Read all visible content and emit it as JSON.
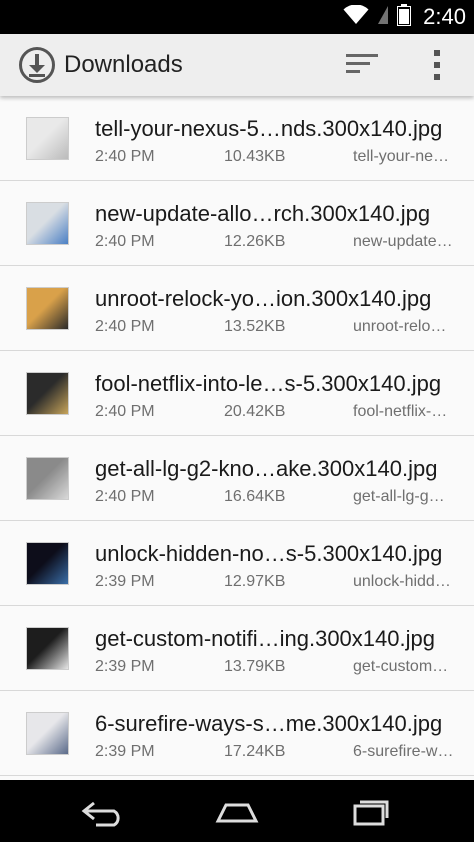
{
  "status_bar": {
    "time": "2:40"
  },
  "app_bar": {
    "title": "Downloads"
  },
  "downloads": [
    {
      "name": "tell-your-nexus-5…nds.300x140.jpg",
      "time": "2:40 PM",
      "size": "10.43KB",
      "source": "tell-your-ne…",
      "thumb_colors": [
        "#e9e9e9",
        "#bbbbbb"
      ]
    },
    {
      "name": "new-update-allo…rch.300x140.jpg",
      "time": "2:40 PM",
      "size": "12.26KB",
      "source": "new-update…",
      "thumb_colors": [
        "#d9dee3",
        "#4a7fc4"
      ]
    },
    {
      "name": "unroot-relock-yo…ion.300x140.jpg",
      "time": "2:40 PM",
      "size": "13.52KB",
      "source": "unroot-relo…",
      "thumb_colors": [
        "#d9a14a",
        "#2a2a2a"
      ]
    },
    {
      "name": "fool-netflix-into-le…s-5.300x140.jpg",
      "time": "2:40 PM",
      "size": "20.42KB",
      "source": "fool-netflix-…",
      "thumb_colors": [
        "#2b2b2b",
        "#c7a45a"
      ]
    },
    {
      "name": "get-all-lg-g2-kno…ake.300x140.jpg",
      "time": "2:40 PM",
      "size": "16.64KB",
      "source": "get-all-lg-g…",
      "thumb_colors": [
        "#8a8a8a",
        "#d9d9d9"
      ]
    },
    {
      "name": "unlock-hidden-no…s-5.300x140.jpg",
      "time": "2:39 PM",
      "size": "12.97KB",
      "source": "unlock-hidd…",
      "thumb_colors": [
        "#0d0d1a",
        "#3a6ea8"
      ]
    },
    {
      "name": "get-custom-notifi…ing.300x140.jpg",
      "time": "2:39 PM",
      "size": "13.79KB",
      "source": "get-custom…",
      "thumb_colors": [
        "#1d1d1d",
        "#e6e6e6"
      ]
    },
    {
      "name": "6-surefire-ways-s…me.300x140.jpg",
      "time": "2:39 PM",
      "size": "17.24KB",
      "source": "6-surefire-w…",
      "thumb_colors": [
        "#e7e7ea",
        "#5a6a8a"
      ]
    }
  ],
  "nav_bar": {
    "icons": [
      "back-icon",
      "home-icon",
      "recents-icon"
    ]
  }
}
